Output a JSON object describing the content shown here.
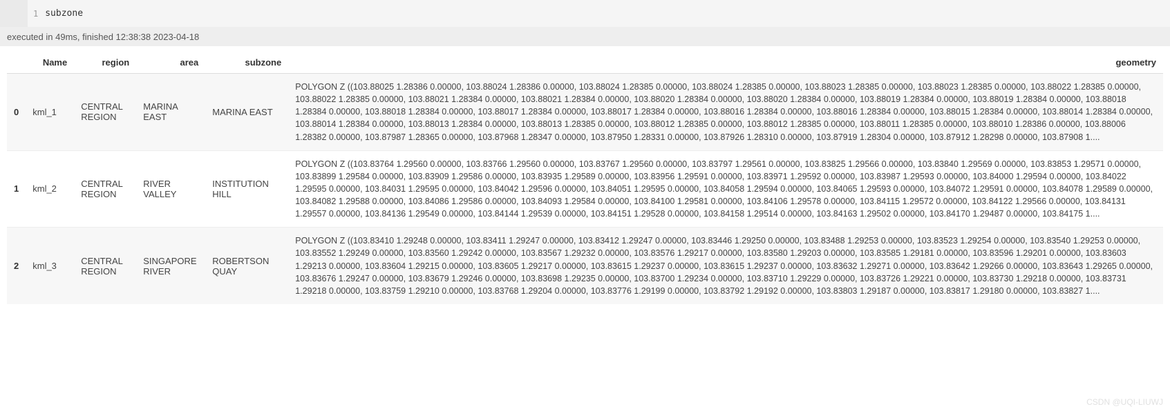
{
  "cell": {
    "line_number": "1",
    "code": "subzone"
  },
  "execution": {
    "status": "executed in 49ms, finished 12:38:38 2023-04-18"
  },
  "table": {
    "columns": [
      "Name",
      "region",
      "area",
      "subzone",
      "geometry"
    ],
    "rows": [
      {
        "index": "0",
        "name": "kml_1",
        "region": "CENTRAL REGION",
        "area": "MARINA EAST",
        "subzone": "MARINA EAST",
        "geometry": "POLYGON Z ((103.88025 1.28386 0.00000, 103.88024 1.28386 0.00000, 103.88024 1.28385 0.00000, 103.88024 1.28385 0.00000, 103.88023 1.28385 0.00000, 103.88023 1.28385 0.00000, 103.88022 1.28385 0.00000, 103.88022 1.28385 0.00000, 103.88021 1.28384 0.00000, 103.88021 1.28384 0.00000, 103.88020 1.28384 0.00000, 103.88020 1.28384 0.00000, 103.88019 1.28384 0.00000, 103.88019 1.28384 0.00000, 103.88018 1.28384 0.00000, 103.88018 1.28384 0.00000, 103.88017 1.28384 0.00000, 103.88017 1.28384 0.00000, 103.88016 1.28384 0.00000, 103.88016 1.28384 0.00000, 103.88015 1.28384 0.00000, 103.88014 1.28384 0.00000, 103.88014 1.28384 0.00000, 103.88013 1.28384 0.00000, 103.88013 1.28385 0.00000, 103.88012 1.28385 0.00000, 103.88012 1.28385 0.00000, 103.88011 1.28385 0.00000, 103.88010 1.28386 0.00000, 103.88006 1.28382 0.00000, 103.87987 1.28365 0.00000, 103.87968 1.28347 0.00000, 103.87950 1.28331 0.00000, 103.87926 1.28310 0.00000, 103.87919 1.28304 0.00000, 103.87912 1.28298 0.00000, 103.87908 1...."
      },
      {
        "index": "1",
        "name": "kml_2",
        "region": "CENTRAL REGION",
        "area": "RIVER VALLEY",
        "subzone": "INSTITUTION HILL",
        "geometry": "POLYGON Z ((103.83764 1.29560 0.00000, 103.83766 1.29560 0.00000, 103.83767 1.29560 0.00000, 103.83797 1.29561 0.00000, 103.83825 1.29566 0.00000, 103.83840 1.29569 0.00000, 103.83853 1.29571 0.00000, 103.83899 1.29584 0.00000, 103.83909 1.29586 0.00000, 103.83935 1.29589 0.00000, 103.83956 1.29591 0.00000, 103.83971 1.29592 0.00000, 103.83987 1.29593 0.00000, 103.84000 1.29594 0.00000, 103.84022 1.29595 0.00000, 103.84031 1.29595 0.00000, 103.84042 1.29596 0.00000, 103.84051 1.29595 0.00000, 103.84058 1.29594 0.00000, 103.84065 1.29593 0.00000, 103.84072 1.29591 0.00000, 103.84078 1.29589 0.00000, 103.84082 1.29588 0.00000, 103.84086 1.29586 0.00000, 103.84093 1.29584 0.00000, 103.84100 1.29581 0.00000, 103.84106 1.29578 0.00000, 103.84115 1.29572 0.00000, 103.84122 1.29566 0.00000, 103.84131 1.29557 0.00000, 103.84136 1.29549 0.00000, 103.84144 1.29539 0.00000, 103.84151 1.29528 0.00000, 103.84158 1.29514 0.00000, 103.84163 1.29502 0.00000, 103.84170 1.29487 0.00000, 103.84175 1...."
      },
      {
        "index": "2",
        "name": "kml_3",
        "region": "CENTRAL REGION",
        "area": "SINGAPORE RIVER",
        "subzone": "ROBERTSON QUAY",
        "geometry": "POLYGON Z ((103.83410 1.29248 0.00000, 103.83411 1.29247 0.00000, 103.83412 1.29247 0.00000, 103.83446 1.29250 0.00000, 103.83488 1.29253 0.00000, 103.83523 1.29254 0.00000, 103.83540 1.29253 0.00000, 103.83552 1.29249 0.00000, 103.83560 1.29242 0.00000, 103.83567 1.29232 0.00000, 103.83576 1.29217 0.00000, 103.83580 1.29203 0.00000, 103.83585 1.29181 0.00000, 103.83596 1.29201 0.00000, 103.83603 1.29213 0.00000, 103.83604 1.29215 0.00000, 103.83605 1.29217 0.00000, 103.83615 1.29237 0.00000, 103.83615 1.29237 0.00000, 103.83632 1.29271 0.00000, 103.83642 1.29266 0.00000, 103.83643 1.29265 0.00000, 103.83676 1.29247 0.00000, 103.83679 1.29246 0.00000, 103.83698 1.29235 0.00000, 103.83700 1.29234 0.00000, 103.83710 1.29229 0.00000, 103.83726 1.29221 0.00000, 103.83730 1.29218 0.00000, 103.83731 1.29218 0.00000, 103.83759 1.29210 0.00000, 103.83768 1.29204 0.00000, 103.83776 1.29199 0.00000, 103.83792 1.29192 0.00000, 103.83803 1.29187 0.00000, 103.83817 1.29180 0.00000, 103.83827 1...."
      }
    ]
  },
  "watermark": "CSDN @UQI-LIUWJ"
}
